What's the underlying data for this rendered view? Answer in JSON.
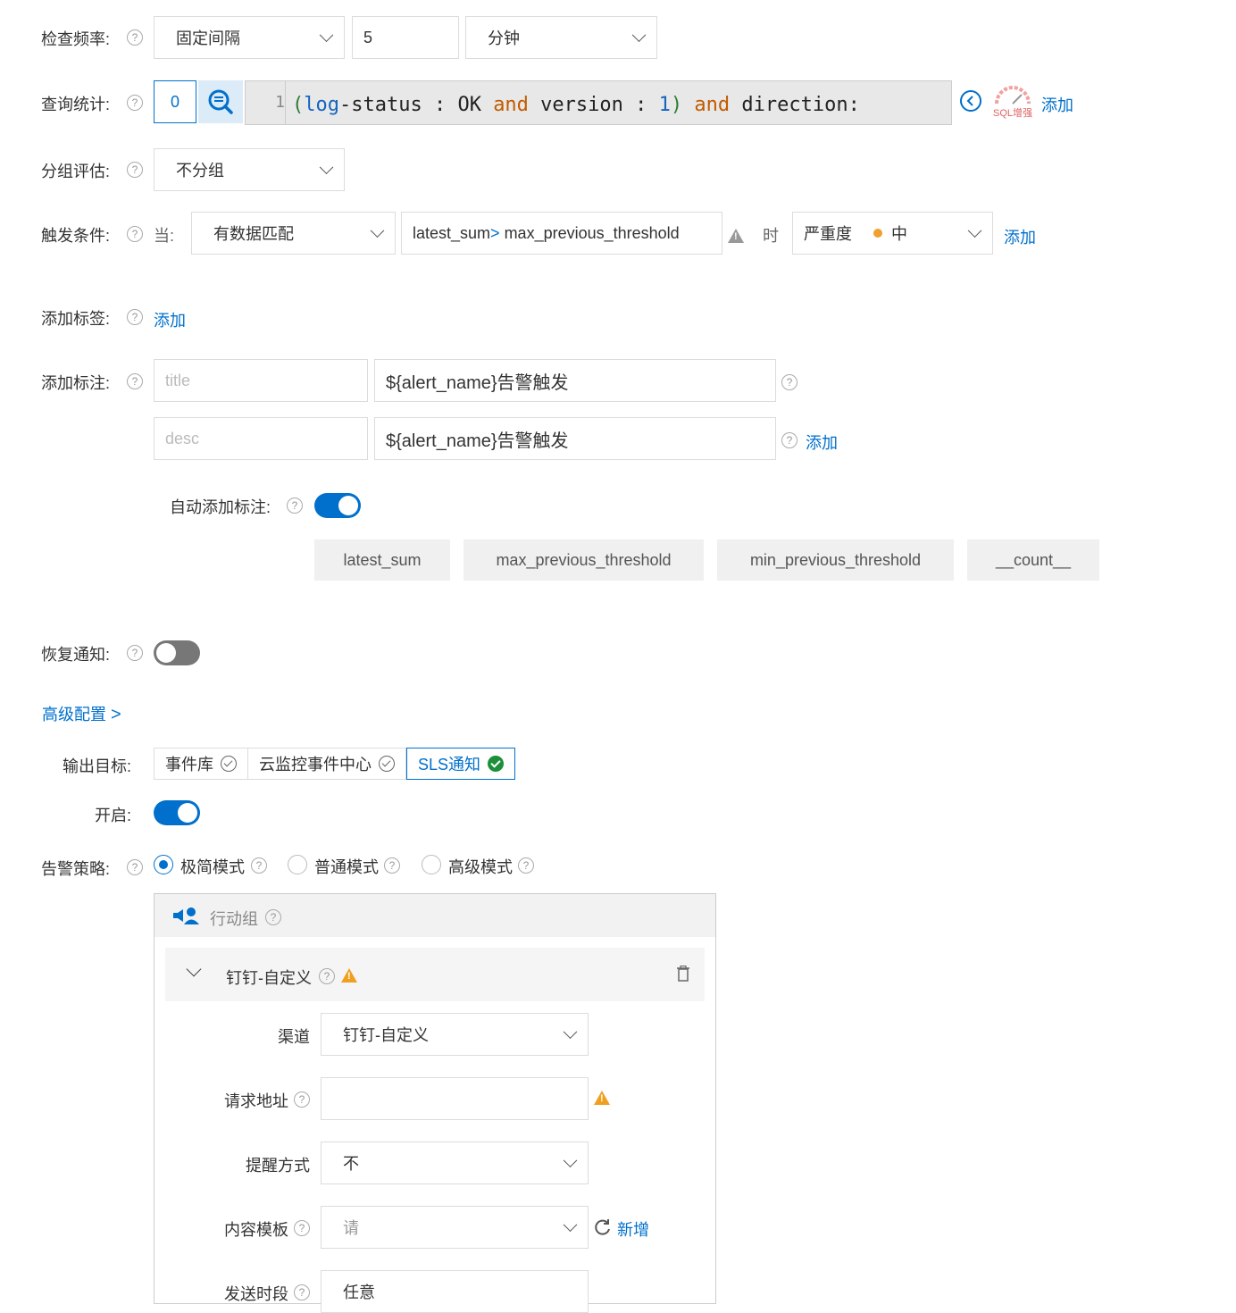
{
  "check_frequency": {
    "label": "检查频率:",
    "mode": "固定间隔",
    "interval": "5",
    "unit": "分钟"
  },
  "query": {
    "label": "查询统计:",
    "index": "0",
    "line_number": "1",
    "code_tokens": {
      "p1": "(",
      "t1": "log",
      "t2": "-status : OK ",
      "k1": "and",
      "t3": " version : ",
      "n1": "1",
      "p2": ")",
      "k2": "and",
      "t4": " direction:"
    },
    "sql_enhance_text": "SQL增强",
    "add_label": "添加"
  },
  "grouping": {
    "label": "分组评估:",
    "value": "不分组"
  },
  "trigger": {
    "label": "触发条件:",
    "when_label": "当:",
    "match": "有数据匹配",
    "expr_a": "latest_sum",
    "expr_op": ">",
    "expr_b": " max_previous_threshold",
    "time_label": "时",
    "severity_label": "严重度",
    "severity_value": "中",
    "severity_color": "#f0a030",
    "add_label": "添加"
  },
  "tags": {
    "label": "添加标签:",
    "add_label": "添加"
  },
  "annotations": {
    "label": "添加标注:",
    "rows": [
      {
        "key_placeholder": "title",
        "value": "${alert_name}告警触发"
      },
      {
        "key_placeholder": "desc",
        "value": "${alert_name}告警触发"
      }
    ],
    "add_label": "添加",
    "auto_label": "自动添加标注:",
    "auto_enabled": true,
    "chips": [
      "latest_sum",
      "max_previous_threshold",
      "min_previous_threshold",
      "__count__"
    ]
  },
  "recovery": {
    "label": "恢复通知:",
    "enabled": false
  },
  "advanced": {
    "label": "高级配置",
    "chevron": ">"
  },
  "output": {
    "label": "输出目标:",
    "targets": [
      {
        "name": "事件库",
        "selected": false
      },
      {
        "name": "云监控事件中心",
        "selected": false
      },
      {
        "name": "SLS通知",
        "selected": true
      }
    ]
  },
  "enable": {
    "label": "开启:",
    "enabled": true
  },
  "policy": {
    "label": "告警策略:",
    "modes": [
      {
        "name": "极简模式",
        "selected": true
      },
      {
        "name": "普通模式",
        "selected": false
      },
      {
        "name": "高级模式",
        "selected": false
      }
    ]
  },
  "action_group": {
    "title": "行动组",
    "item_title": "钉钉-自定义",
    "channel_label": "渠道",
    "channel_value": "钉钉-自定义",
    "url_label": "请求地址",
    "remind_label": "提醒方式",
    "remind_value": "不",
    "template_label": "内容模板",
    "template_value": "请",
    "new_label": "新增",
    "send_label": "发送时段",
    "send_value": "任意"
  },
  "colors": {
    "primary": "#0070cc",
    "success": "#1b8f3a",
    "warning": "#f0a020"
  }
}
